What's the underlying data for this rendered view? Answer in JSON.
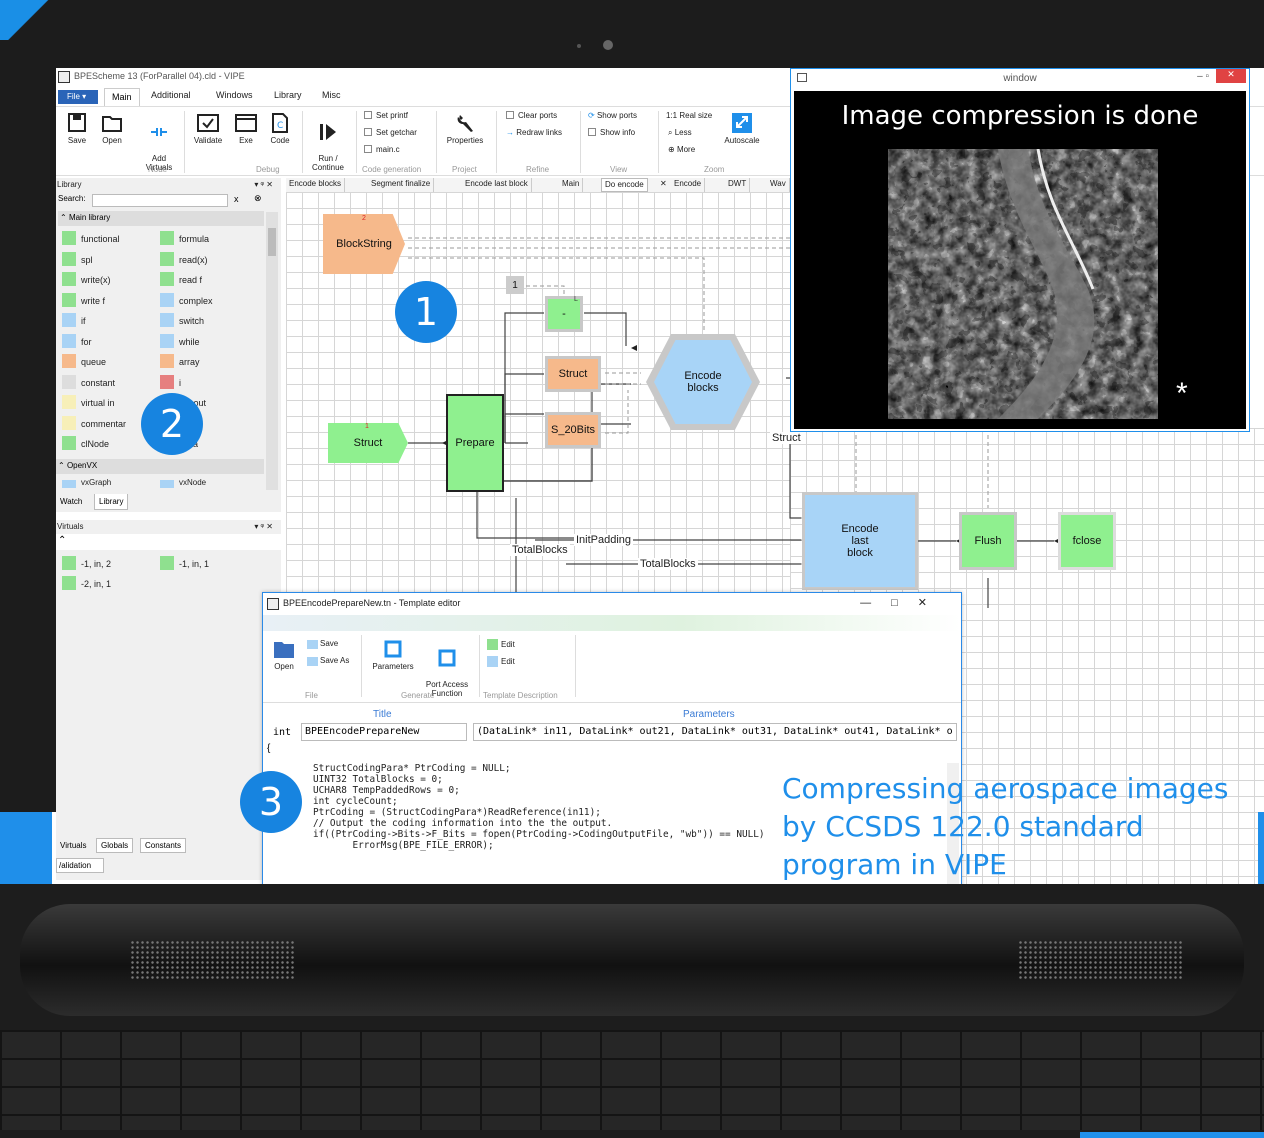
{
  "app": {
    "title": "BPEScheme 13 (ForParallel 04).cld - VIPE",
    "ribbon_tabs": [
      "File",
      "Main",
      "Additional",
      "Windows",
      "Library",
      "Misc"
    ]
  },
  "ribbon": {
    "save": "Save",
    "open": "Open",
    "add_virtuals": "Add\nVirtuals",
    "validate": "Validate",
    "exe": "Exe",
    "code": "Code",
    "run_continue": "Run /\nContinue",
    "set_printf": "Set printf",
    "set_getchar": "Set getchar",
    "main_c": "main.c",
    "properties": "Properties",
    "clear_ports": "Clear ports",
    "redraw_links": "Redraw links",
    "show_ports": "Show ports",
    "show_info": "Show info",
    "real_size": "1:1 Real size",
    "less": "Less",
    "more": "More",
    "autoscale": "Autoscale",
    "groups": {
      "node": "Node",
      "debug": "Debug",
      "code_generation": "Code generation",
      "project": "Project",
      "refine": "Refine",
      "view": "View",
      "zoom": "Zoom"
    }
  },
  "library": {
    "title": "Library",
    "search_label": "Search:",
    "main_section": "Main library",
    "openvx_section": "OpenVX",
    "items_left": [
      {
        "label": "functional",
        "color": "#8fe08f"
      },
      {
        "label": "spl",
        "color": "#8fe08f"
      },
      {
        "label": "write(x)",
        "color": "#8fe08f"
      },
      {
        "label": "write f",
        "color": "#8fe08f"
      },
      {
        "label": "if",
        "color": "#a9d3f5"
      },
      {
        "label": "for",
        "color": "#a9d3f5"
      },
      {
        "label": "queue",
        "color": "#f6b98b"
      },
      {
        "label": "constant",
        "color": "#dddddd"
      },
      {
        "label": "virtual in",
        "color": "#f7efb8"
      },
      {
        "label": "commentar",
        "color": "#f7efb8"
      },
      {
        "label": "clNode",
        "color": "#8fe08f"
      }
    ],
    "items_right": [
      {
        "label": "formula",
        "color": "#8fe08f"
      },
      {
        "label": "read(x)",
        "color": "#8fe08f"
      },
      {
        "label": "read f",
        "color": "#8fe08f"
      },
      {
        "label": "complex",
        "color": "#a9d3f5"
      },
      {
        "label": "switch",
        "color": "#a9d3f5"
      },
      {
        "label": "while",
        "color": "#a9d3f5"
      },
      {
        "label": "array",
        "color": "#f6b98b"
      },
      {
        "label": "i",
        "color": "#e67f7f"
      },
      {
        "label": "ual out",
        "color": "#f7efb8"
      },
      {
        "label": "de",
        "color": "#f7efb8"
      },
      {
        "label": "Data",
        "color": "#a9d3f5"
      }
    ],
    "openvx_items": [
      "vxGraph",
      "vxNode"
    ],
    "bottom_tabs": [
      "Watch",
      "Library"
    ]
  },
  "virtuals": {
    "title": "Virtuals",
    "items": [
      "-1, in, 2",
      "-1, in, 1",
      "-2, in, 1"
    ],
    "bottom_tabs": [
      "Virtuals",
      "Globals",
      "Constants"
    ],
    "validation_tab": "/alidation"
  },
  "doc_tabs": [
    "Encode blocks",
    "Segment finalize",
    "Encode last block",
    "Main",
    "Do encode",
    "Encode",
    "DWT",
    "Wav"
  ],
  "scheme": {
    "blockstring": "BlockString",
    "blockstring_port": "2",
    "const_one": "1",
    "minus": "-",
    "minus_l": "L",
    "struct_orange": "Struct",
    "s20": "S_20Bits",
    "struct_green": "Struct",
    "struct_green_port": "1",
    "prepare": "Prepare",
    "encode_blocks": "Encode\nblocks",
    "encode_last": "Encode\nlast\nblock",
    "flush": "Flush",
    "fclose": "fclose",
    "wire_struct": "Struct",
    "wire_initpadding": "InitPadding",
    "wire_totalblocks1": "TotalBlocks",
    "wire_totalblocks2": "TotalBlocks"
  },
  "image_window": {
    "title": "window",
    "heading": "Image compression is done",
    "marker": "*"
  },
  "template_editor": {
    "title": "BPEEncodePrepareNew.tn - Template editor",
    "open": "Open",
    "save": "Save",
    "save_as": "Save As",
    "parameters": "Parameters",
    "port_access": "Port Access\nFunction",
    "edit1": "Edit",
    "edit2": "Edit",
    "groups": {
      "file": "File",
      "generate": "Generate",
      "template_description": "Template Description"
    },
    "title_header": "Title",
    "parameters_header": "Parameters",
    "return_type": "int",
    "func_name": "BPEEncodePrepareNew",
    "params": "(DataLink* in11, DataLink* out21, DataLink* out31, DataLink* out41, DataLink* o",
    "brace": "{",
    "code_lines": [
      "StructCodingPara* PtrCoding = NULL;",
      "UINT32 TotalBlocks = 0;",
      "UCHAR8 TempPaddedRows = 0;",
      "int cycleCount;",
      "",
      "PtrCoding = (StructCodingPara*)ReadReference(in11);",
      "",
      "// Output the coding information into the the output.",
      "if((PtrCoding->Bits->F_Bits = fopen(PtrCoding->CodingOutputFile, \"wb\")) == NULL)",
      "       ErrorMsg(BPE_FILE_ERROR);"
    ]
  },
  "badges": [
    "1",
    "2",
    "3"
  ],
  "caption": [
    "Compressing aerospace images",
    "by CCSDS 122.0 standard",
    "program in VIPE"
  ],
  "colors": {
    "accent": "#1f8fea",
    "node_green": "#8ff08f",
    "node_blue": "#a8d4f7",
    "node_orange": "#f6b98b"
  }
}
